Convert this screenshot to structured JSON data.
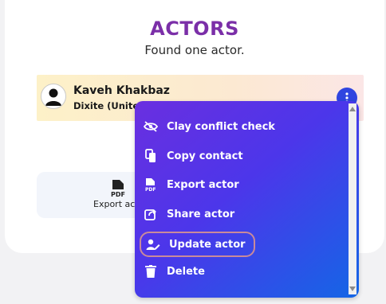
{
  "header": {
    "title": "ACTORS",
    "subtitle": "Found one actor."
  },
  "actor": {
    "name": "Kaveh Khakbaz",
    "subtitle": "Dixite (United S"
  },
  "export_tile": {
    "label": "Export acto",
    "icon": "pdf-file-icon"
  },
  "menu": {
    "items": [
      {
        "label": "Clay conflict check",
        "icon": "conflict-check-icon"
      },
      {
        "label": "Copy contact",
        "icon": "copy-icon"
      },
      {
        "label": "Export actor",
        "icon": "pdf-file-icon"
      },
      {
        "label": "Share actor",
        "icon": "share-icon"
      },
      {
        "label": "Update actor",
        "icon": "user-edit-icon"
      },
      {
        "label": "Delete",
        "icon": "trash-icon"
      }
    ]
  },
  "colors": {
    "title": "#7b2fa8",
    "menu_start": "#6a2fe0",
    "menu_end": "#1466e6",
    "kebab": "#2f45e0",
    "highlight_border": "#c98a9a"
  }
}
